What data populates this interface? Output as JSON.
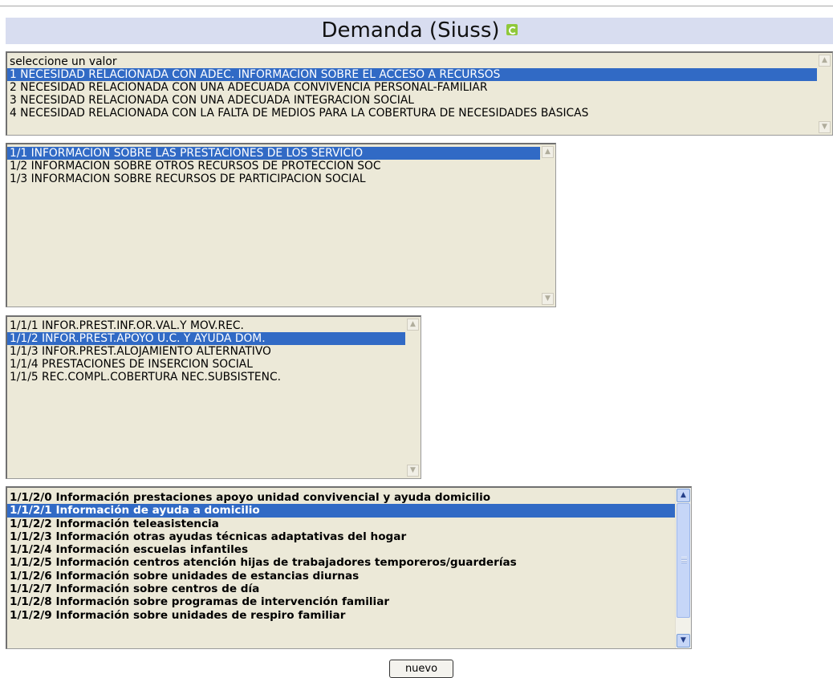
{
  "title": "Demanda (Siuss)",
  "icons": {
    "refresh": "refresh-icon"
  },
  "colors": {
    "title_band": "#d8ddf0",
    "listbox_bg": "#ece9d8",
    "selection": "#316ac5"
  },
  "list1": {
    "selected_index": 1,
    "options": [
      "seleccione un valor",
      "1 NECESIDAD RELACIONADA CON ADEC. INFORMACION SOBRE EL ACCESO A RECURSOS",
      "2 NECESIDAD RELACIONADA CON UNA ADECUADA CONVIVENCIA PERSONAL-FAMILIAR",
      "3 NECESIDAD RELACIONADA CON UNA ADECUADA INTEGRACION SOCIAL",
      "4 NECESIDAD RELACIONADA CON LA FALTA DE MEDIOS PARA LA COBERTURA DE NECESIDADES BÁSICAS"
    ]
  },
  "list2": {
    "selected_index": 0,
    "options": [
      "1/1 INFORMACION SOBRE LAS PRESTACIONES DE LOS SERVICIO",
      "1/2 INFORMACION SOBRE OTROS RECURSOS DE PROTECCION SOC",
      "1/3 INFORMACION SOBRE RECURSOS DE PARTICIPACION SOCIAL"
    ]
  },
  "list3": {
    "selected_index": 1,
    "options": [
      "1/1/1 INFOR.PREST.INF.OR.VAL.Y MOV.REC.",
      "1/1/2 INFOR.PREST.APOYO U.C. Y AYUDA DOM.",
      "1/1/3 INFOR.PREST.ALOJAMIENTO ALTERNATIVO",
      "1/1/4 PRESTACIONES DE INSERCION SOCIAL",
      "1/1/5 REC.COMPL.COBERTURA NEC.SUBSISTENC."
    ]
  },
  "list4": {
    "selected_index": 1,
    "options": [
      "1/1/2/0 Información prestaciones apoyo unidad convivencial y ayuda domicilio",
      "1/1/2/1 Información de ayuda a domicilio",
      "1/1/2/2 Información teleasistencia",
      "1/1/2/3 Información otras ayudas técnicas adaptativas del hogar",
      "1/1/2/4 Información escuelas infantiles",
      "1/1/2/5 Información centros atención hijas de trabajadores temporeros/guarderías",
      "1/1/2/6 Información sobre unidades de estancias diurnas",
      "1/1/2/7 Información sobre centros de día",
      "1/1/2/8 Información sobre programas de intervención familiar",
      "1/1/2/9 Información sobre unidades de respiro familiar"
    ]
  },
  "buttons": {
    "nuevo": "nuevo"
  }
}
